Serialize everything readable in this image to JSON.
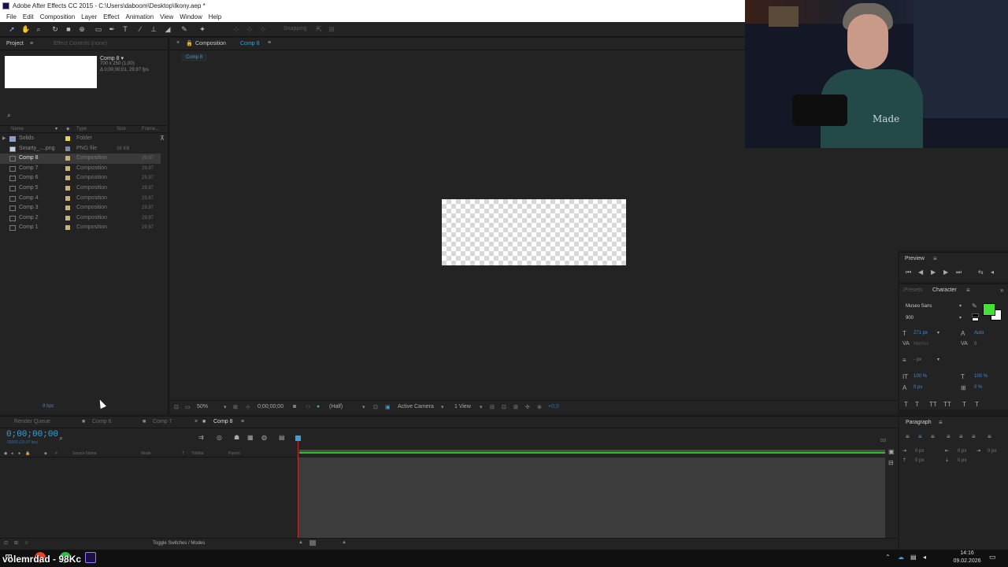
{
  "window": {
    "title": "Adobe After Effects CC 2015 - C:\\Users\\daboom\\Desktop\\Ikony.aep *"
  },
  "menu": [
    "File",
    "Edit",
    "Composition",
    "Layer",
    "Effect",
    "Animation",
    "View",
    "Window",
    "Help"
  ],
  "toolbar": {
    "snapping_label": "Snapping"
  },
  "project": {
    "tab_project": "Project",
    "tab_effect_controls": "Effect Controls (none)",
    "selected_name": "Comp 8 ▾",
    "selected_info_1": "700 x 250 (1,00)",
    "selected_info_2": "Δ 0;00;00;01, 29,97 fps",
    "columns": {
      "name": "Name",
      "type": "Type",
      "size": "Size",
      "frame": "Frame..."
    },
    "items": [
      {
        "name": "Solids",
        "type": "Folder",
        "size": "",
        "frame": "",
        "label_color": "#e6d64a"
      },
      {
        "name": "Smarty_....png",
        "type": "PNG file",
        "size": "38 KB",
        "frame": "",
        "label_color": "#7a8aa8"
      },
      {
        "name": "Comp 8",
        "type": "Composition",
        "size": "",
        "frame": "29,97",
        "label_color": "#c8b47a"
      },
      {
        "name": "Comp 7",
        "type": "Composition",
        "size": "",
        "frame": "29,97",
        "label_color": "#c8b47a"
      },
      {
        "name": "Comp 6",
        "type": "Composition",
        "size": "",
        "frame": "29,97",
        "label_color": "#c8b47a"
      },
      {
        "name": "Comp 5",
        "type": "Composition",
        "size": "",
        "frame": "29,97",
        "label_color": "#c8b47a"
      },
      {
        "name": "Comp 4",
        "type": "Composition",
        "size": "",
        "frame": "29,97",
        "label_color": "#c8b47a"
      },
      {
        "name": "Comp 3",
        "type": "Composition",
        "size": "",
        "frame": "29,97",
        "label_color": "#c8b47a"
      },
      {
        "name": "Comp 2",
        "type": "Composition",
        "size": "",
        "frame": "29,97",
        "label_color": "#c8b47a"
      },
      {
        "name": "Comp 1",
        "type": "Composition",
        "size": "",
        "frame": "29,97",
        "label_color": "#c8b47a"
      }
    ],
    "bpc": "8 bpc"
  },
  "composition": {
    "tab_label": "Composition",
    "tab_comp": "Comp 8",
    "breadcrumb": "Comp 8",
    "zoom": "50%",
    "timecode": "0;00;00;00",
    "resolution": "(Half)",
    "camera": "Active Camera",
    "views": "1 View",
    "exposure": "+0,0"
  },
  "webcam": {
    "shirt_text": "Made"
  },
  "preview": {
    "title": "Preview"
  },
  "character": {
    "tab_presets": "...Presets",
    "title": "Character",
    "font": "Museo Sans",
    "weight": "900",
    "size": "271 px",
    "leading": "Auto",
    "kerning": "Metrics",
    "tracking": "0",
    "stroke": "- px",
    "vscale": "100 %",
    "hscale": "100 %",
    "baseline": "0 px",
    "tsume": "0 %",
    "fill_color": "#46e03a"
  },
  "paragraph": {
    "title": "Paragraph",
    "v1": "0 px",
    "v2": "0 px",
    "v3": "0 px",
    "v4": "0 px",
    "v5": "0 px"
  },
  "timeline": {
    "tab_render": "Render Queue",
    "tab_comp6": "Comp 6",
    "tab_comp7": "Comp 7",
    "tab_comp8": "Comp 8",
    "timecode": "0;00;00;00",
    "timecode_sub": "00000 (29.97 fps)",
    "col_source": "Source Name",
    "col_mode": "Mode",
    "col_t": "T",
    "col_trkmat": "TrkMat",
    "col_parent": "Parent",
    "toggle_label": "Toggle Switches / Modes",
    "ruler_end": "01f"
  },
  "taskbar": {
    "stream_text": "volemrdad - 98Kc",
    "time": "14:16",
    "date": "09.02.2026"
  }
}
